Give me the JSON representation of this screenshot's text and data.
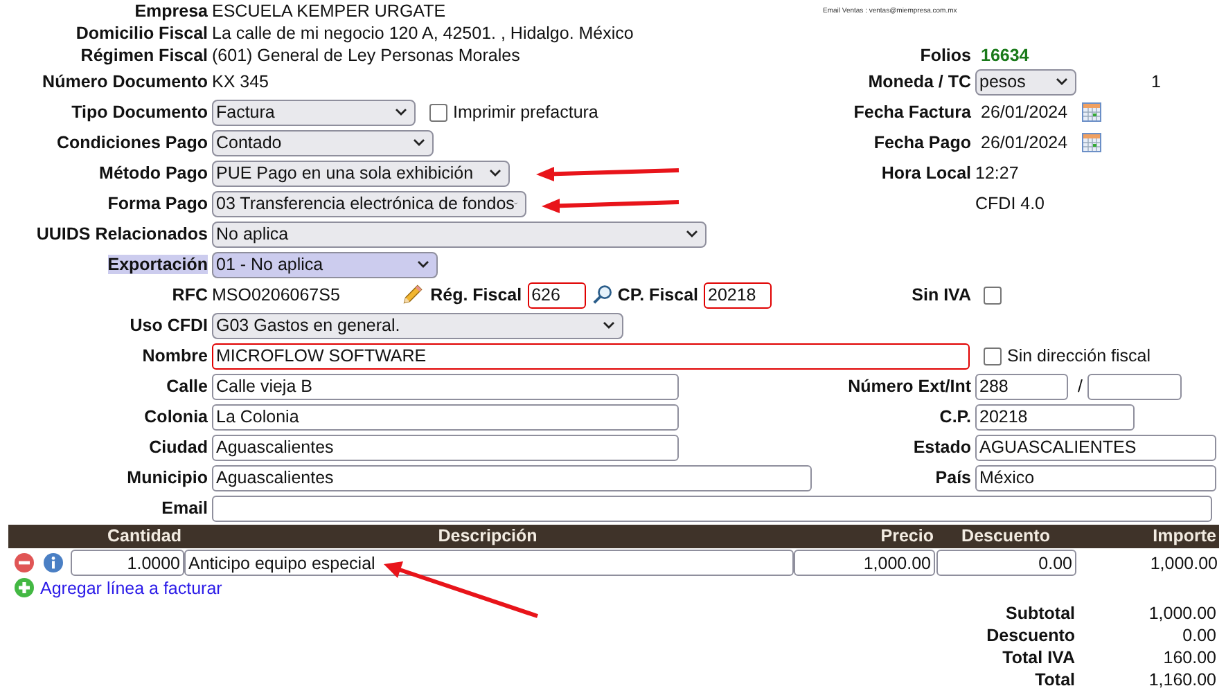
{
  "email_ventas": "Email Ventas : ventas@miempresa.com.mx",
  "empresa": {
    "label": "Empresa",
    "value": "ESCUELA KEMPER URGATE"
  },
  "domicilio_fiscal": {
    "label": "Domicilio Fiscal",
    "value": "La calle de mi negocio 120 A, 42501. , Hidalgo. México"
  },
  "regimen_fiscal": {
    "label": "Régimen Fiscal",
    "value": "(601) General de Ley Personas Morales"
  },
  "folios": {
    "label": "Folios",
    "value": "16634"
  },
  "numero_documento": {
    "label": "Número Documento",
    "value": "KX 345"
  },
  "moneda": {
    "label": "Moneda / TC",
    "value": "pesos",
    "tc": "1"
  },
  "tipo_documento": {
    "label": "Tipo Documento",
    "value": "Factura",
    "prefactura": {
      "label": "Imprimir prefactura",
      "checked": false
    }
  },
  "fecha_factura": {
    "label": "Fecha Factura",
    "value": "26/01/2024"
  },
  "condiciones_pago": {
    "label": "Condiciones Pago",
    "value": "Contado"
  },
  "fecha_pago": {
    "label": "Fecha Pago",
    "value": "26/01/2024"
  },
  "metodo_pago": {
    "label": "Método Pago",
    "value": "PUE Pago en una sola exhibición"
  },
  "hora_local": {
    "label": "Hora Local",
    "value": "12:27"
  },
  "forma_pago": {
    "label": "Forma Pago",
    "value": "03 Transferencia electrónica de fondos"
  },
  "cfdi_version": "CFDI 4.0",
  "uuids_relacionados": {
    "label": "UUIDS Relacionados",
    "value": "No aplica"
  },
  "exportacion": {
    "label": "Exportación",
    "value": "01 - No aplica",
    "highlighted": true
  },
  "rfc": {
    "label": "RFC",
    "value": "MSO0206067S5"
  },
  "regimen_fiscal_cliente": {
    "label": "Rég. Fiscal",
    "value": "626",
    "invalid": true
  },
  "cp_fiscal": {
    "label": "CP. Fiscal",
    "value": "20218",
    "invalid": true
  },
  "sin_iva": {
    "label": "Sin IVA",
    "checked": false
  },
  "uso_cfdi": {
    "label": "Uso CFDI",
    "value": "G03 Gastos en general."
  },
  "nombre": {
    "label": "Nombre",
    "value": "MICROFLOW SOFTWARE",
    "invalid": true
  },
  "sin_direccion_fiscal": {
    "label": "Sin dirección fiscal",
    "checked": false
  },
  "calle": {
    "label": "Calle",
    "value": "Calle vieja B"
  },
  "numero_ext_int": {
    "label": "Número Ext/Int",
    "ext": "288",
    "separator": "/"
  },
  "colonia": {
    "label": "Colonia",
    "value": "La Colonia"
  },
  "cp": {
    "label": "C.P.",
    "value": "20218"
  },
  "ciudad": {
    "label": "Ciudad",
    "value": "Aguascalientes"
  },
  "estado": {
    "label": "Estado",
    "value": "AGUASCALIENTES"
  },
  "municipio": {
    "label": "Municipio",
    "value": "Aguascalientes"
  },
  "pais": {
    "label": "País",
    "value": "México"
  },
  "email": {
    "label": "Email"
  },
  "lines": {
    "columns": [
      "Cantidad",
      "Descripción",
      "Precio",
      "Descuento",
      "Importe"
    ],
    "rows": [
      {
        "cantidad": "1.0000",
        "descripcion": "Anticipo equipo especial",
        "precio": "1,000.00",
        "descuento": "0.00",
        "importe": "1,000.00"
      }
    ],
    "add_link": "Agregar línea a facturar"
  },
  "totals": [
    {
      "label": "Subtotal",
      "value": "1,000.00"
    },
    {
      "label": "Descuento",
      "value": "0.00"
    },
    {
      "label": "Total IVA",
      "value": "160.00"
    },
    {
      "label": "Total",
      "value": "1,160.00"
    }
  ]
}
